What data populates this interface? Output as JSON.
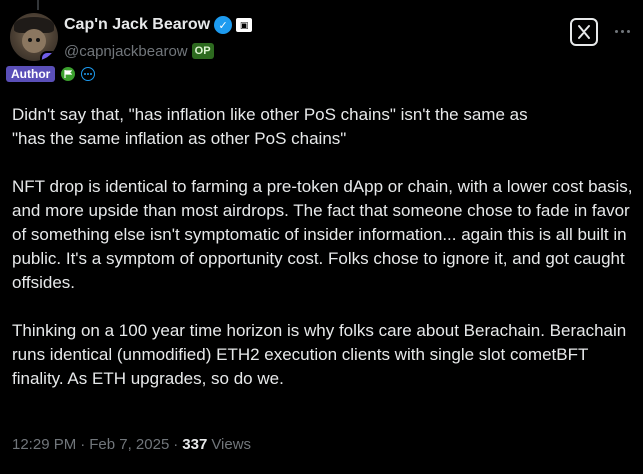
{
  "author": {
    "display_name": "Cap'n Jack Bearow",
    "handle": "@capnjackbearow",
    "op_badge": "OP",
    "author_badge": "Author",
    "verified_color": "#1d9bf0"
  },
  "icons": {
    "verified": "verified-check-icon",
    "affiliation": "affiliate-badge-icon",
    "flag": "flag-icon",
    "more_circle": "more-circle-icon",
    "grok": "grok-icon",
    "more": "more-horizontal-icon"
  },
  "tweet": {
    "paragraphs": [
      "Didn't say that, \"has inflation like other PoS chains\" isn't the same as\n\"has the same inflation as other PoS chains\"",
      "NFT drop is identical to farming a pre-token dApp or chain, with a lower cost basis, and more upside than most airdrops. The fact that someone chose to fade in favor of something else isn't symptomatic of insider information... again this is all built in public. It's a symptom of opportunity cost. Folks chose to ignore it, and got caught offsides.",
      "Thinking on a 100 year time horizon is why folks care about Berachain. Berachain runs identical (unmodified) ETH2 execution clients with single slot cometBFT finality. As ETH upgrades, so do we."
    ]
  },
  "meta": {
    "time": "12:29 PM",
    "separator": "·",
    "date": "Feb 7, 2025",
    "views_count": "337",
    "views_label": "Views"
  }
}
